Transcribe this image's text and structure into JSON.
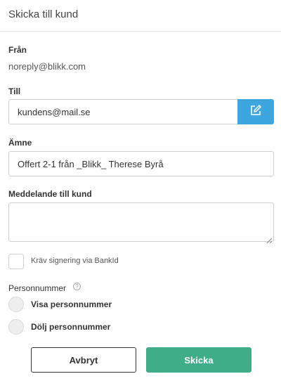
{
  "dialog": {
    "title": "Skicka till kund"
  },
  "from": {
    "label": "Från",
    "value": "noreply@blikk.com"
  },
  "to": {
    "label": "Till",
    "value": "kundens@mail.se",
    "edit_icon": "edit-icon"
  },
  "subject": {
    "label": "Ämne",
    "value": "Offert 2-1 från _Blikk_ Therese Byrå"
  },
  "message": {
    "label": "Meddelande till kund",
    "value": ""
  },
  "bankid": {
    "label": "Kräv signering via BankId",
    "checked": false
  },
  "personnummer": {
    "label": "Personnummer",
    "help_icon": "?",
    "options": [
      "Visa personnummer",
      "Dölj personnummer"
    ]
  },
  "buttons": {
    "cancel": "Avbryt",
    "send": "Skicka"
  },
  "colors": {
    "accent_blue": "#3ea6df",
    "send_green": "#3fae88"
  }
}
